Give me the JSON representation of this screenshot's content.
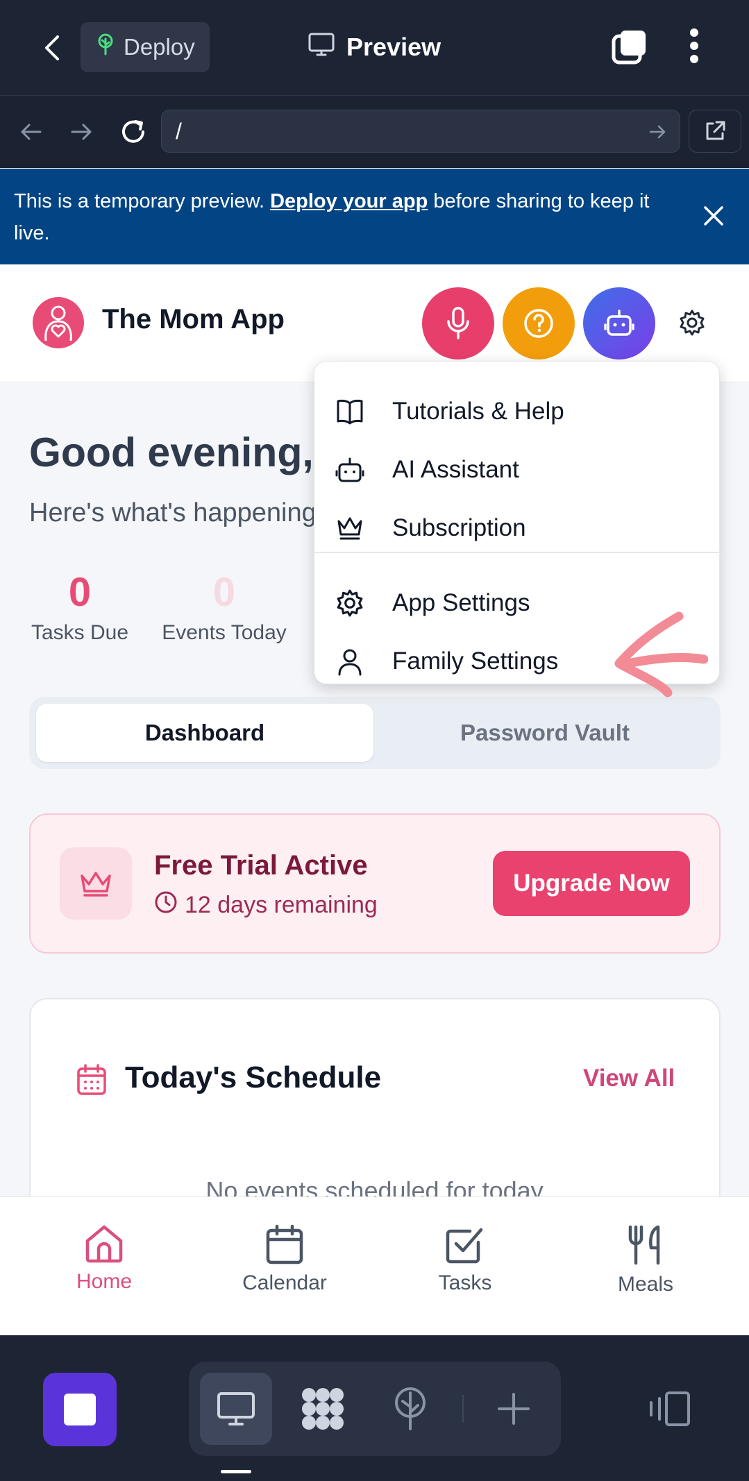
{
  "host": {
    "deploy_label": "Deploy",
    "preview_label": "Preview",
    "url_value": "/"
  },
  "banner": {
    "text_before": "This is a temporary preview. ",
    "link_text": "Deploy your app",
    "text_after": " before sharing to keep it live."
  },
  "app": {
    "title": "The Mom App"
  },
  "greeting": {
    "title": "Good evening,",
    "subtitle": "Here's what's happening"
  },
  "stats": [
    {
      "value": "0",
      "label": "Tasks Due",
      "color": "#e84c76"
    },
    {
      "value": "0",
      "label": "Events Today",
      "color": "#f6d9e2"
    }
  ],
  "menu": {
    "items": [
      {
        "label": "Tutorials & Help",
        "icon": "book-icon"
      },
      {
        "label": "AI Assistant",
        "icon": "robot-icon"
      },
      {
        "label": "Subscription",
        "icon": "crown-icon"
      },
      {
        "label": "App Settings",
        "icon": "gear-icon"
      },
      {
        "label": "Family Settings",
        "icon": "user-icon"
      }
    ]
  },
  "tabs": {
    "active": "Dashboard",
    "inactive": "Password Vault"
  },
  "trial": {
    "title": "Free Trial Active",
    "remaining": "12 days remaining",
    "button": "Upgrade Now"
  },
  "schedule": {
    "title": "Today's Schedule",
    "view_all": "View All",
    "empty": "No events scheduled for today"
  },
  "nav": {
    "items": [
      {
        "label": "Home",
        "icon": "home-icon",
        "active": true
      },
      {
        "label": "Calendar",
        "icon": "calendar-icon",
        "active": false
      },
      {
        "label": "Tasks",
        "icon": "checkbox-icon",
        "active": false
      },
      {
        "label": "Meals",
        "icon": "utensils-icon",
        "active": false
      }
    ]
  },
  "colors": {
    "accent": "#e84c76",
    "mic_button": "#e83e6c",
    "help_button": "#f29e0c",
    "ai_button": "#5b5be8",
    "banner": "#034584",
    "host_bg": "#1d2434"
  }
}
